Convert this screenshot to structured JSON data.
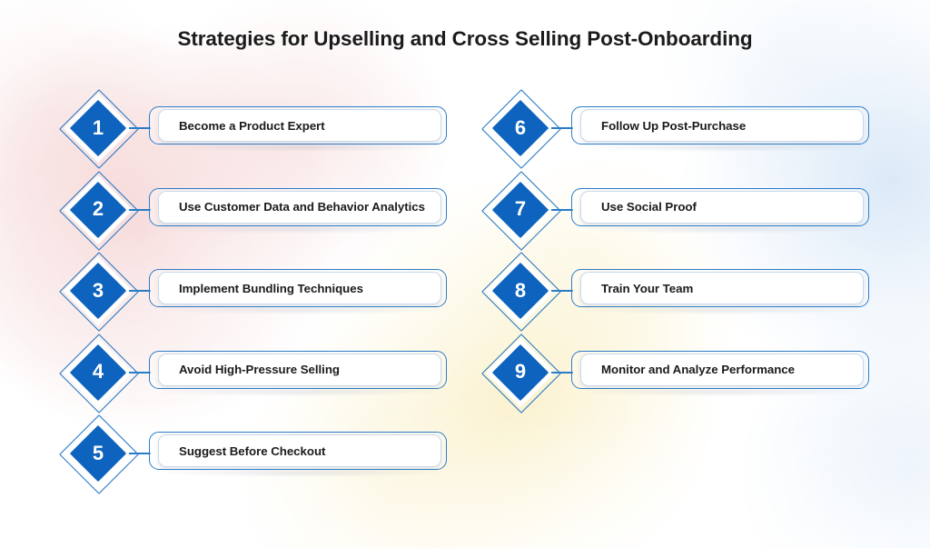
{
  "title": "Strategies for Upselling and Cross Selling Post-Onboarding",
  "theme": {
    "diamond_fill": "#0d63bd",
    "diamond_ring": "#ffffff",
    "card_border": "#2c7dc8",
    "card_background": "#ffffff",
    "connector": "#2a7cc7",
    "text": "#1b1b1b",
    "background_pink": "#f4cece",
    "background_yellow": "#faf0c8",
    "background_blue": "#d6e6f6"
  },
  "columns": {
    "left": [
      {
        "number": "1",
        "label": "Become a Product Expert"
      },
      {
        "number": "2",
        "label": "Use Customer Data and Behavior Analytics"
      },
      {
        "number": "3",
        "label": "Implement Bundling Techniques"
      },
      {
        "number": "4",
        "label": "Avoid High-Pressure Selling"
      },
      {
        "number": "5",
        "label": "Suggest Before Checkout"
      }
    ],
    "right": [
      {
        "number": "6",
        "label": "Follow Up Post-Purchase"
      },
      {
        "number": "7",
        "label": "Use Social Proof"
      },
      {
        "number": "8",
        "label": "Train Your Team"
      },
      {
        "number": "9",
        "label": "Monitor and Analyze Performance"
      }
    ]
  }
}
